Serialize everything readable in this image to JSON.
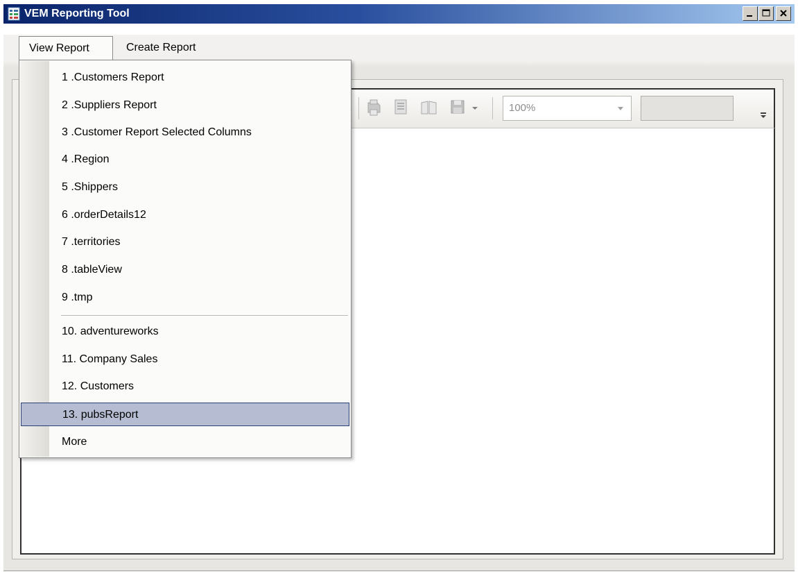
{
  "window": {
    "title": "VEM Reporting Tool",
    "buttons": {
      "minimize": "minimize-icon",
      "maximize": "maximize-icon",
      "close": "close-icon"
    }
  },
  "menubar": {
    "items": [
      {
        "label": "View Report"
      },
      {
        "label": "Create Report"
      }
    ]
  },
  "view_report_menu": {
    "items": [
      {
        "label": "1 .Customers Report"
      },
      {
        "label": "2 .Suppliers Report"
      },
      {
        "label": "3 .Customer Report Selected Columns"
      },
      {
        "label": "4 .Region"
      },
      {
        "label": "5 .Shippers"
      },
      {
        "label": "6 .orderDetails12"
      },
      {
        "label": "7 .territories"
      },
      {
        "label": "8 .tableView"
      },
      {
        "label": "9 .tmp"
      },
      {
        "label": "10. adventureworks"
      },
      {
        "label": "11. Company Sales"
      },
      {
        "label": "12. Customers"
      },
      {
        "label": "13. pubsReport"
      },
      {
        "label": "More"
      }
    ],
    "highlighted_index": 12
  },
  "toolbar": {
    "zoom_value": "100%",
    "find_value": ""
  },
  "colors": {
    "titlebar_start": "#0a246a",
    "titlebar_end": "#a6caf0",
    "highlight": "#b6bdd2",
    "highlight_border": "#2c3f74"
  }
}
